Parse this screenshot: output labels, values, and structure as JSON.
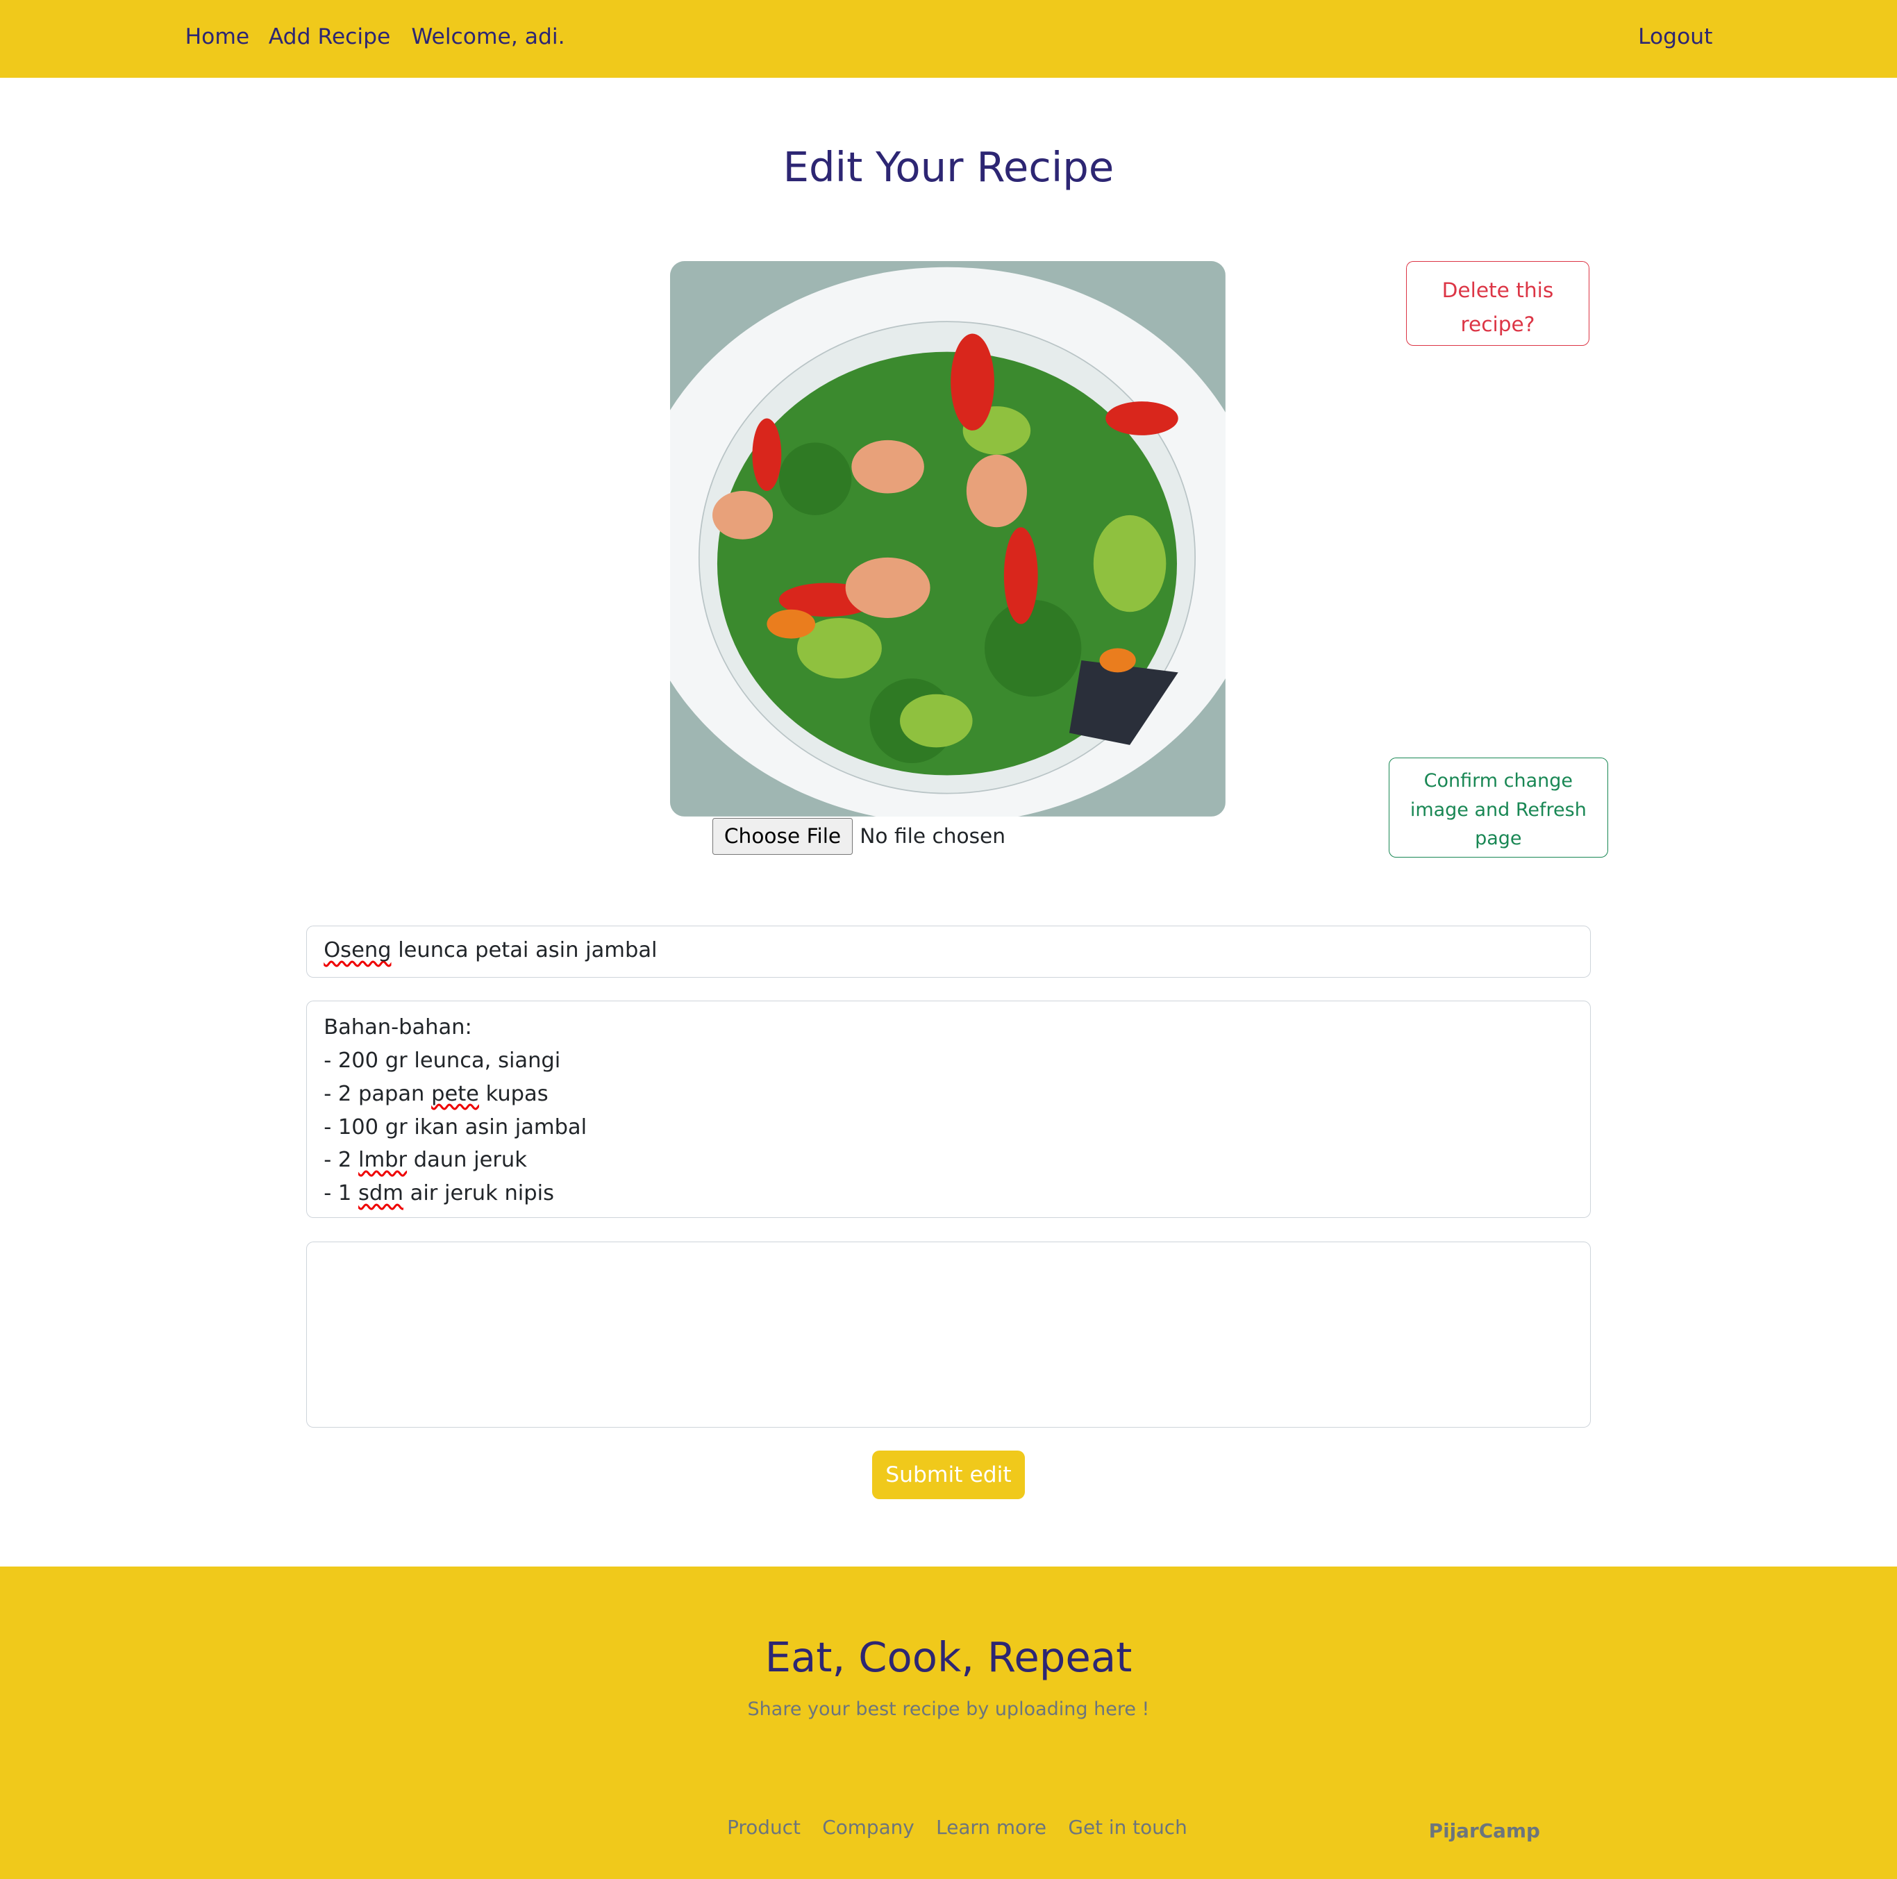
{
  "nav": {
    "home": "Home",
    "add_recipe": "Add Recipe",
    "welcome": "Welcome, adi.",
    "logout": "Logout"
  },
  "page_title": "Edit Your Recipe",
  "image": {
    "alt": "Oseng leunca petai asin jambal"
  },
  "delete_button": "Delete this recipe?",
  "confirm_button": "Confirm change image and Refresh page",
  "file_input": {
    "button": "Choose File",
    "status": "No file chosen"
  },
  "form": {
    "title_value": {
      "w1": "Oseng",
      "rest": " leunca petai asin jambal"
    },
    "ingredients_lines": [
      "Bahan-bahan:",
      "- 200 gr leunca, siangi",
      "- 2 papan pete kupas",
      "- 100 gr ikan asin jambal",
      "- 2 lmbr daun jeruk",
      "- 1 sdm air jeruk nipis"
    ],
    "steps_value": "",
    "submit": "Submit edit"
  },
  "footer": {
    "title": "Eat, Cook, Repeat",
    "subtitle": "Share your best recipe by uploading here !",
    "links": [
      "Product",
      "Company",
      "Learn more",
      "Get in touch"
    ],
    "brand": "PijarCamp"
  },
  "colors": {
    "brand_yellow": "#f0c91b",
    "navy": "#2d2673",
    "danger": "#dc3545",
    "success": "#198754"
  }
}
